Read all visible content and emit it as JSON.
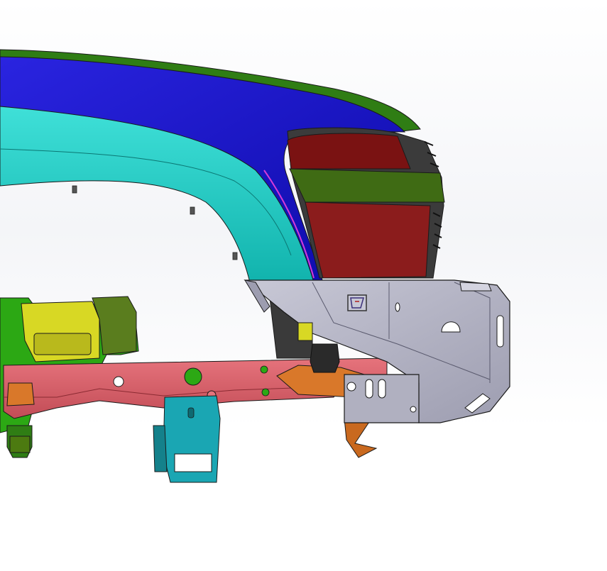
{
  "scene": {
    "background": "#ffffff",
    "colors": {
      "fender_green": "#2f7d14",
      "fender_blue": "#1712c8",
      "fender_cyan": "#16c7c0",
      "taillight_red": "#7a1212",
      "taillight_green": "#3f6b14",
      "bracket_gray": "#b9b9c8",
      "frame_red": "#d9606a",
      "mount_green": "#2ca814",
      "mount_yellow": "#d8d824",
      "mount_teal": "#1aa6b3",
      "bracket_orange": "#d9782a",
      "edge_black": "#1a1a1a"
    }
  }
}
